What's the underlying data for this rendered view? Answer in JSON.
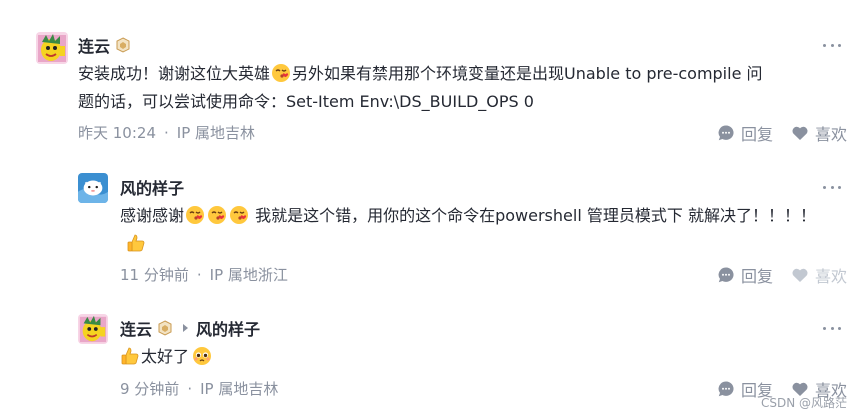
{
  "comments": [
    {
      "author": "连云",
      "reply_to": "",
      "text_before_emoji": "安装成功！谢谢这位大英雄",
      "text_after_emoji": "另外如果有禁用那个环境变量还是出现Unable to pre-compile 问题的话，可以尝试使用命令：Set-Item Env:\\DS_BUILD_OPS 0",
      "time": "昨天 10:24",
      "location": "IP 属地吉林",
      "reply_label": "回复",
      "like_label": "喜欢"
    },
    {
      "author": "风的样子",
      "reply_to": "",
      "text_prefix": "感谢感谢",
      "text_body": " 我就是这个错，用你的这个命令在powershell 管理员模式下 就解决了！！！！",
      "time": "11 分钟前",
      "location": "IP 属地浙江",
      "reply_label": "回复",
      "like_label": "喜欢"
    },
    {
      "author": "连云",
      "reply_to": "风的样子",
      "text": "太好了",
      "time": "9 分钟前",
      "location": "IP 属地吉林",
      "reply_label": "回复",
      "like_label": "喜欢"
    }
  ],
  "meta_separator": "·",
  "watermark": "CSDN @风路茫",
  "icons": {
    "more": "more-dots-icon",
    "reply": "comment-bubble-icon",
    "like": "heart-icon",
    "level_badge": "level-badge-icon",
    "emoji_kiss": "kissing-face-emoji",
    "emoji_thumbs": "thumbs-up-emoji",
    "emoji_pleading": "pleading-face-emoji"
  },
  "colors": {
    "text": "#252933",
    "muted": "#8a919f",
    "disabled": "#c2c8d1"
  }
}
